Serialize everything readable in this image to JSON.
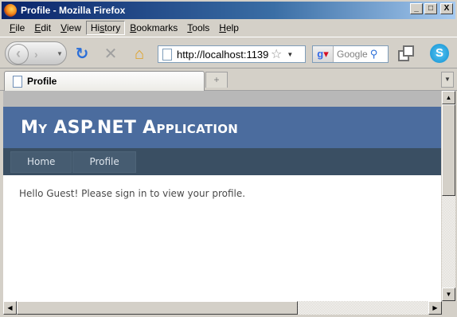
{
  "window": {
    "title": "Profile - Mozilla Firefox",
    "controls": {
      "minimize": "_",
      "maximize": "□",
      "close": "X"
    }
  },
  "menubar": {
    "items": [
      {
        "label": "File",
        "underline": "F"
      },
      {
        "label": "Edit",
        "underline": "E"
      },
      {
        "label": "View",
        "underline": "V"
      },
      {
        "label": "History",
        "underline": "s"
      },
      {
        "label": "Bookmarks",
        "underline": "B"
      },
      {
        "label": "Tools",
        "underline": "T"
      },
      {
        "label": "Help",
        "underline": "H"
      }
    ],
    "active": "History"
  },
  "toolbar": {
    "address": "http://localhost:1139",
    "search_placeholder": "Google",
    "skype_badge": "S"
  },
  "tabs": [
    {
      "label": "Profile",
      "active": true
    }
  ],
  "page": {
    "app_title": "My ASP.NET Application",
    "nav": [
      "Home",
      "Profile"
    ],
    "message": "Hello Guest! Please sign in to view your profile."
  },
  "colors": {
    "header_bg": "#4b6c9e",
    "nav_bg": "#3a4f63",
    "nav_item_bg": "#465c71"
  }
}
